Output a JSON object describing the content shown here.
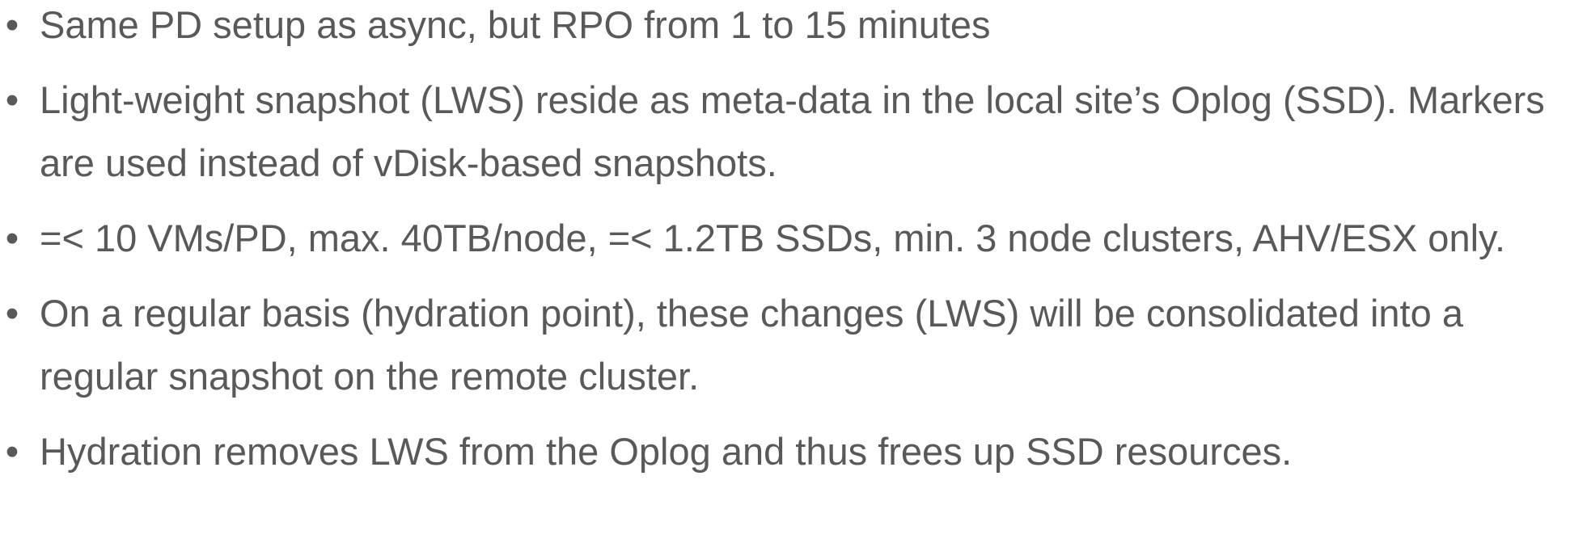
{
  "slide": {
    "bullet_char": "•",
    "items": [
      "Same PD setup as async, but RPO from 1 to 15 minutes",
      "Light-weight snapshot (LWS) reside as meta-data in the local site’s Oplog (SSD). Markers are used instead of vDisk-based snapshots.",
      "=< 10 VMs/PD, max. 40TB/node, =< 1.2TB SSDs, min. 3 node clusters, AHV/ESX only.",
      "On a regular basis (hydration point), these changes (LWS) will be consolidated into a regular snapshot on the remote cluster.",
      "Hydration removes LWS from the Oplog and thus frees up SSD resources."
    ]
  },
  "colors": {
    "text": "#595959",
    "background": "#ffffff"
  }
}
